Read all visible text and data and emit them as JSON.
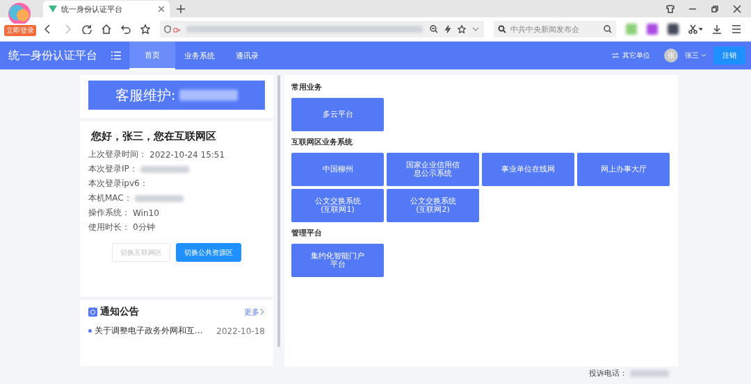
{
  "browser": {
    "login_badge": "立即登录",
    "tab_title": "统一身份认证平台",
    "search_placeholder": "中共中央新闻发布会"
  },
  "header": {
    "title": "统一身份认证平台",
    "nav": [
      {
        "label": "首页",
        "selected": true
      },
      {
        "label": "业务系统",
        "selected": false
      },
      {
        "label": "通讯录",
        "selected": false
      }
    ],
    "switch_unit": "其它单位",
    "avatar": "张",
    "user": "张三",
    "logout": "注销"
  },
  "service_banner": {
    "label": "客服维护:"
  },
  "welcome": {
    "greeting": "您好，张三，您在互联网区",
    "info": [
      {
        "kind": "text",
        "label": "上次登录时间：",
        "value": "2022-10-24 15:51"
      },
      {
        "kind": "redacted",
        "label": "本次登录IP："
      },
      {
        "kind": "text",
        "label": "本次登录ipv6："
      },
      {
        "kind": "redacted",
        "label": "本机MAC："
      },
      {
        "kind": "text",
        "label": "操作系统：",
        "value": "Win10"
      },
      {
        "kind": "text",
        "label": "使用时长：",
        "value": "0分钟"
      }
    ],
    "buttons": [
      {
        "label": "切换互联网区",
        "disabled": true
      },
      {
        "label": "切换公共资源区",
        "disabled": false
      }
    ]
  },
  "notice": {
    "title": "通知公告",
    "more": "更多",
    "items": [
      {
        "title": "关于调整电子政务外网和互...",
        "date": "2022-10-18"
      }
    ]
  },
  "sections": [
    {
      "title": "常用业务",
      "tiles": [
        [
          "多云平台"
        ]
      ]
    },
    {
      "title": "互联网区业务系统",
      "tiles": [
        [
          "中国柳州"
        ],
        [
          "国家企业信用信",
          "息公示系统"
        ],
        [
          "事业单位在线网"
        ],
        [
          "网上办事大厅"
        ],
        [
          "公文交换系统",
          "(互联网1)"
        ],
        [
          "公文交换系统",
          "(互联网2)"
        ]
      ]
    },
    {
      "title": "管理平台",
      "tiles": [
        [
          "集约化智能门户",
          "平台"
        ]
      ]
    }
  ],
  "footer": {
    "label": "投诉电话："
  }
}
